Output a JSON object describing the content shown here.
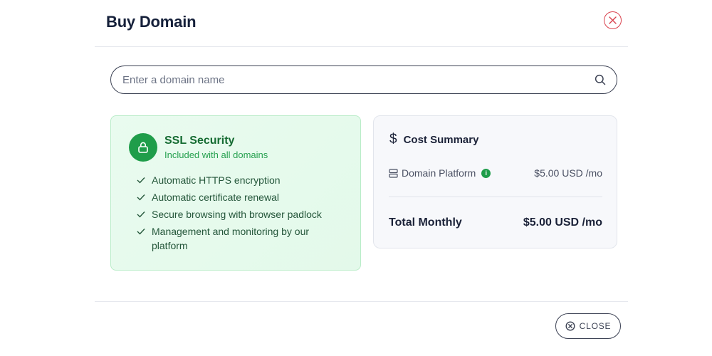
{
  "dialog": {
    "title": "Buy Domain",
    "close_icon": "close-circle-icon"
  },
  "search": {
    "placeholder": "Enter a domain name",
    "value": "",
    "icon": "search-icon"
  },
  "ssl": {
    "icon": "lock-icon",
    "title": "SSL Security",
    "subtitle": "Included with all domains",
    "features": [
      "Automatic HTTPS encryption",
      "Automatic certificate renewal",
      "Secure browsing with browser padlock",
      "Management and monitoring by our platform"
    ],
    "accent_color": "#1f9d4a"
  },
  "cost_summary": {
    "icon": "dollar-icon",
    "title": "Cost Summary",
    "line_items": [
      {
        "icon": "server-icon",
        "label": "Domain Platform",
        "info_icon": "info-icon",
        "price": "$5.00 USD /mo"
      }
    ],
    "total_label": "Total Monthly",
    "total_price": "$5.00 USD /mo"
  },
  "footer": {
    "close_label": "CLOSE",
    "close_icon": "close-circle-icon"
  }
}
